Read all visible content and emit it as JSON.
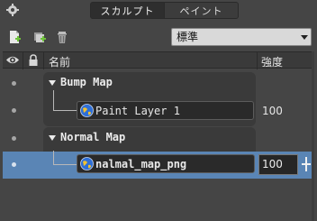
{
  "mode_tabs": [
    "スカルプト",
    "ペイント"
  ],
  "toolbar": {
    "icons": [
      "new-layer-icon",
      "duplicate-layer-icon",
      "delete-layer-icon"
    ],
    "blend_mode": "標準"
  },
  "table": {
    "columns": {
      "visibility_icon": "eye-icon",
      "lock_icon": "lock-icon",
      "name": "名前",
      "strength": "強度"
    }
  },
  "layers": {
    "group1": {
      "label": "Bump Map"
    },
    "layer1": {
      "label": "Paint Layer 1",
      "strength": "100"
    },
    "group2": {
      "label": "Normal Map"
    },
    "layer2": {
      "label": "nalmal_map_png",
      "strength": "100"
    }
  },
  "colors": {
    "selected_row": "#5a85b5",
    "panel_bg": "#454545"
  }
}
